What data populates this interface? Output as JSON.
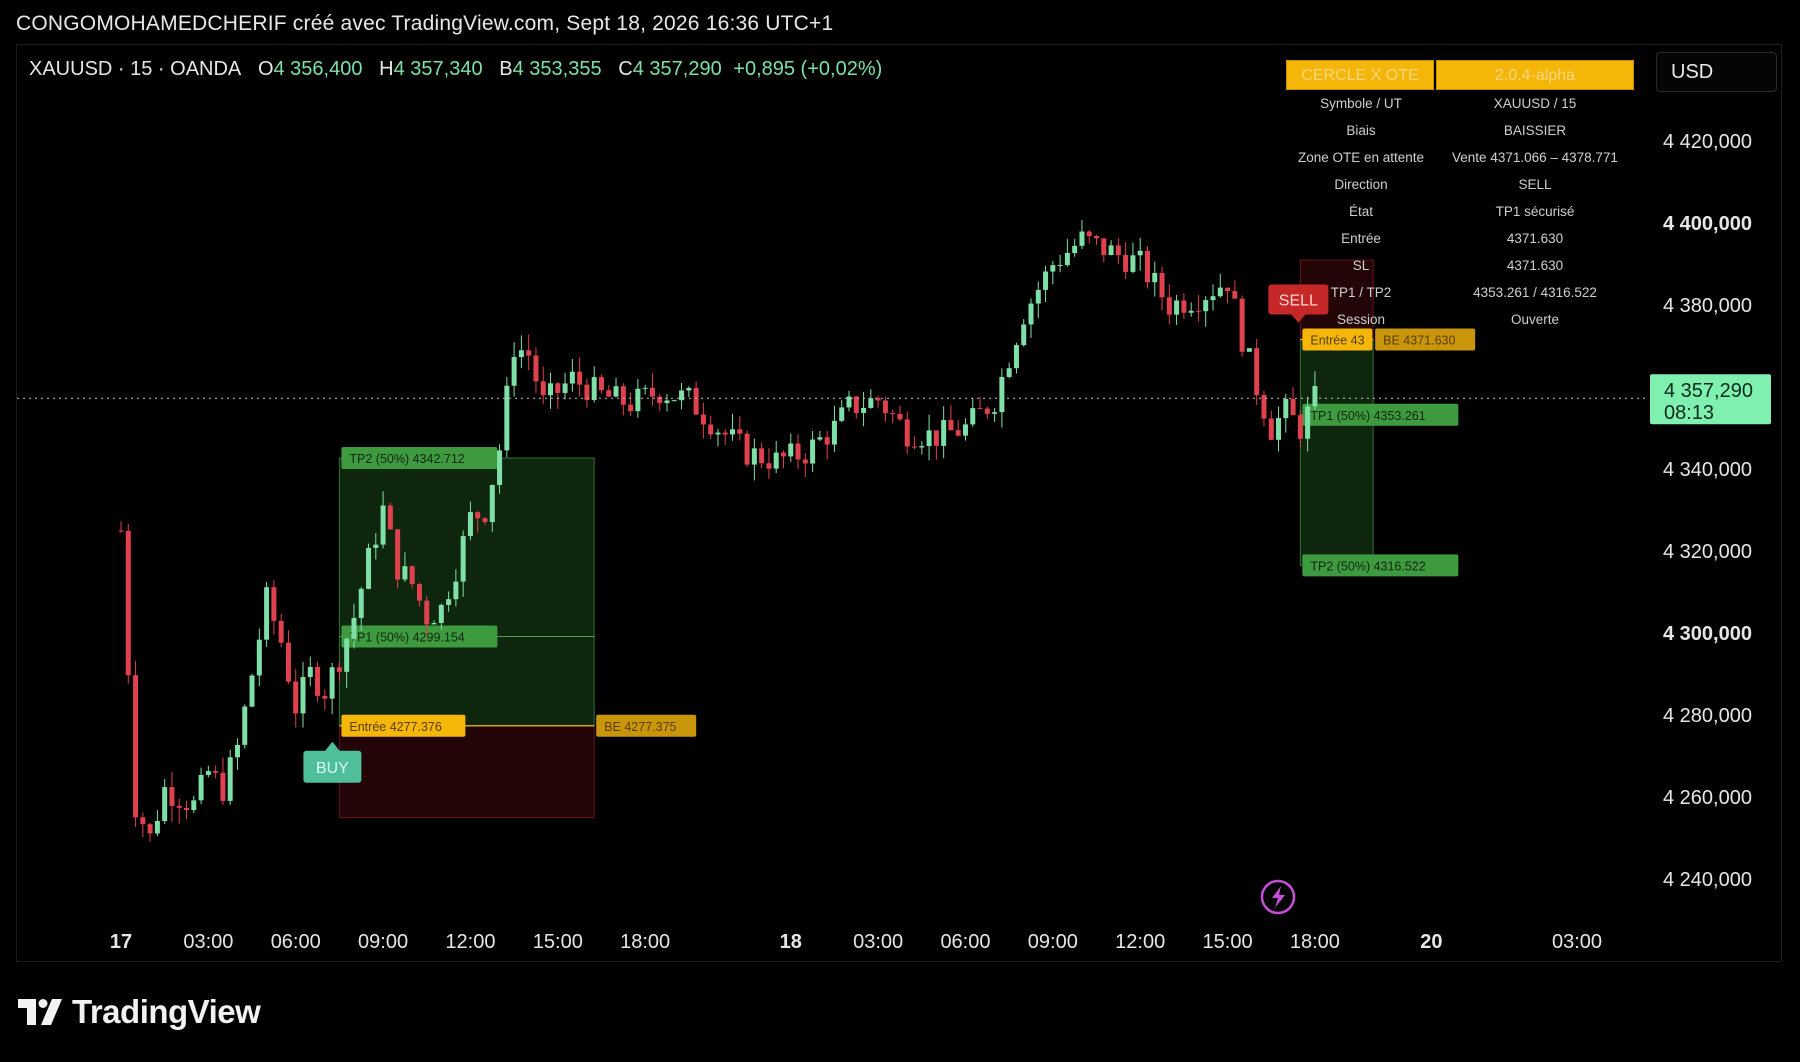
{
  "header": {
    "title": "CONGOMOHAMEDCHERIF créé avec TradingView.com, Sept 18, 2026 16:36 UTC+1"
  },
  "ohlc": {
    "symbol": "XAUUSD · 15 · OANDA",
    "o_label": "O",
    "o": "4 356,400",
    "h_label": "H",
    "h": "4 357,340",
    "b_label": "B",
    "b": "4 353,355",
    "c_label": "C",
    "c": "4 357,290",
    "change": "+0,895 (+0,02%)"
  },
  "currency_button": "USD",
  "ote_panel": {
    "title": "CERCLE X OTE",
    "version": "2.0.4-alpha",
    "rows": [
      {
        "label": "Symbole / UT",
        "value": "XAUUSD / 15"
      },
      {
        "label": "Biais",
        "value": "BAISSIER"
      },
      {
        "label": "Zone OTE en attente",
        "value": "Vente 4371.066 – 4378.771"
      },
      {
        "label": "Direction",
        "value": "SELL"
      },
      {
        "label": "État",
        "value": "TP1 sécurisé"
      },
      {
        "label": "Entrée",
        "value": "4371.630"
      },
      {
        "label": "SL",
        "value": "4371.630"
      },
      {
        "label": "TP1 / TP2",
        "value": "4353.261 / 4316.522"
      },
      {
        "label": "Session",
        "value": "Ouverte"
      }
    ]
  },
  "footer": {
    "brand": "TradingView"
  },
  "colors": {
    "up": "#7ee0a6",
    "down": "#e0414e",
    "gold": "#f5b60a",
    "tp_green": "#3e9a3e",
    "sell_red": "#c62828",
    "buy_teal": "#4fbf9b",
    "price_tag": "#7ff0b0"
  },
  "chart_data": {
    "type": "candlestick",
    "symbol": "XAUUSD",
    "interval": "15",
    "ylim": [
      4230,
      4432
    ],
    "y_ticks": [
      {
        "value": 4420,
        "label": "4 420,000",
        "bold": false
      },
      {
        "value": 4400,
        "label": "4 400,000",
        "bold": true
      },
      {
        "value": 4380,
        "label": "4 380,000",
        "bold": false
      },
      {
        "value": 4360,
        "label": "4 360,000",
        "bold": false
      },
      {
        "value": 4340,
        "label": "4 340,000",
        "bold": false
      },
      {
        "value": 4320,
        "label": "4 320,000",
        "bold": false
      },
      {
        "value": 4300,
        "label": "4 300,000",
        "bold": true
      },
      {
        "value": 4280,
        "label": "4 280,000",
        "bold": false
      },
      {
        "value": 4260,
        "label": "4 260,000",
        "bold": false
      },
      {
        "value": 4240,
        "label": "4 240,000",
        "bold": false
      }
    ],
    "x_ticks": [
      {
        "pos": 0,
        "label": "17",
        "bold": true
      },
      {
        "pos": 12,
        "label": "03:00",
        "bold": false
      },
      {
        "pos": 24,
        "label": "06:00",
        "bold": false
      },
      {
        "pos": 36,
        "label": "09:00",
        "bold": false
      },
      {
        "pos": 48,
        "label": "12:00",
        "bold": false
      },
      {
        "pos": 60,
        "label": "15:00",
        "bold": false
      },
      {
        "pos": 72,
        "label": "18:00",
        "bold": false
      },
      {
        "pos": 92,
        "label": "18",
        "bold": true
      },
      {
        "pos": 104,
        "label": "03:00",
        "bold": false
      },
      {
        "pos": 116,
        "label": "06:00",
        "bold": false
      },
      {
        "pos": 128,
        "label": "09:00",
        "bold": false
      },
      {
        "pos": 140,
        "label": "12:00",
        "bold": false
      },
      {
        "pos": 152,
        "label": "15:00",
        "bold": false
      },
      {
        "pos": 164,
        "label": "18:00",
        "bold": false
      },
      {
        "pos": 180,
        "label": "20",
        "bold": true
      },
      {
        "pos": 200,
        "label": "03:00",
        "bold": false
      }
    ],
    "current_price": {
      "value": 4357.29,
      "label": "4 357,290",
      "countdown": "08:13"
    },
    "path": [
      [
        0,
        4325
      ],
      [
        2,
        4258
      ],
      [
        4,
        4250
      ],
      [
        6,
        4262
      ],
      [
        10,
        4258
      ],
      [
        12,
        4266
      ],
      [
        14,
        4262
      ],
      [
        16,
        4272
      ],
      [
        18,
        4290
      ],
      [
        20,
        4308
      ],
      [
        22,
        4298
      ],
      [
        24,
        4282
      ],
      [
        26,
        4290
      ],
      [
        28,
        4286
      ],
      [
        30,
        4294
      ],
      [
        32,
        4304
      ],
      [
        34,
        4318
      ],
      [
        36,
        4330
      ],
      [
        38,
        4316
      ],
      [
        40,
        4312
      ],
      [
        42,
        4304
      ],
      [
        44,
        4306
      ],
      [
        46,
        4316
      ],
      [
        48,
        4328
      ],
      [
        50,
        4330
      ],
      [
        52,
        4345
      ],
      [
        54,
        4370
      ],
      [
        56,
        4368
      ],
      [
        58,
        4356
      ],
      [
        62,
        4362
      ],
      [
        66,
        4358
      ],
      [
        70,
        4356
      ],
      [
        74,
        4359
      ],
      [
        78,
        4357
      ],
      [
        82,
        4350
      ],
      [
        86,
        4344
      ],
      [
        90,
        4342
      ],
      [
        94,
        4344
      ],
      [
        98,
        4350
      ],
      [
        100,
        4355
      ],
      [
        104,
        4357
      ],
      [
        108,
        4349
      ],
      [
        112,
        4348
      ],
      [
        116,
        4350
      ],
      [
        120,
        4357
      ],
      [
        124,
        4378
      ],
      [
        128,
        4390
      ],
      [
        132,
        4396
      ],
      [
        136,
        4393
      ],
      [
        140,
        4390
      ],
      [
        144,
        4380
      ],
      [
        148,
        4382
      ],
      [
        152,
        4386
      ],
      [
        154,
        4372
      ],
      [
        156,
        4360
      ],
      [
        158,
        4350
      ],
      [
        160,
        4354
      ],
      [
        162,
        4350
      ],
      [
        164,
        4357
      ]
    ],
    "buy_trade": {
      "signal": "BUY",
      "x_start": 30,
      "x_end": 65,
      "entry": 4277.376,
      "entry_label": "Entrée 4277.376",
      "be_label": "BE 4277.375",
      "tp1": 4299.154,
      "tp1_label": "TP1 (50%) 4299.154",
      "tp2": 4342.712,
      "tp2_label": "TP2 (50%) 4342.712",
      "sl": 4255
    },
    "sell_trade": {
      "signal": "SELL",
      "x_start": 162,
      "x_end": 172,
      "entry": 4371.63,
      "entry_label": "Entrée 43",
      "be_label": "BE 4371.630",
      "tp1": 4353.261,
      "tp1_label": "TP1 (50%) 4353.261",
      "tp2": 4316.522,
      "tp2_label": "TP2 (50%) 4316.522",
      "sl": 4391
    }
  }
}
